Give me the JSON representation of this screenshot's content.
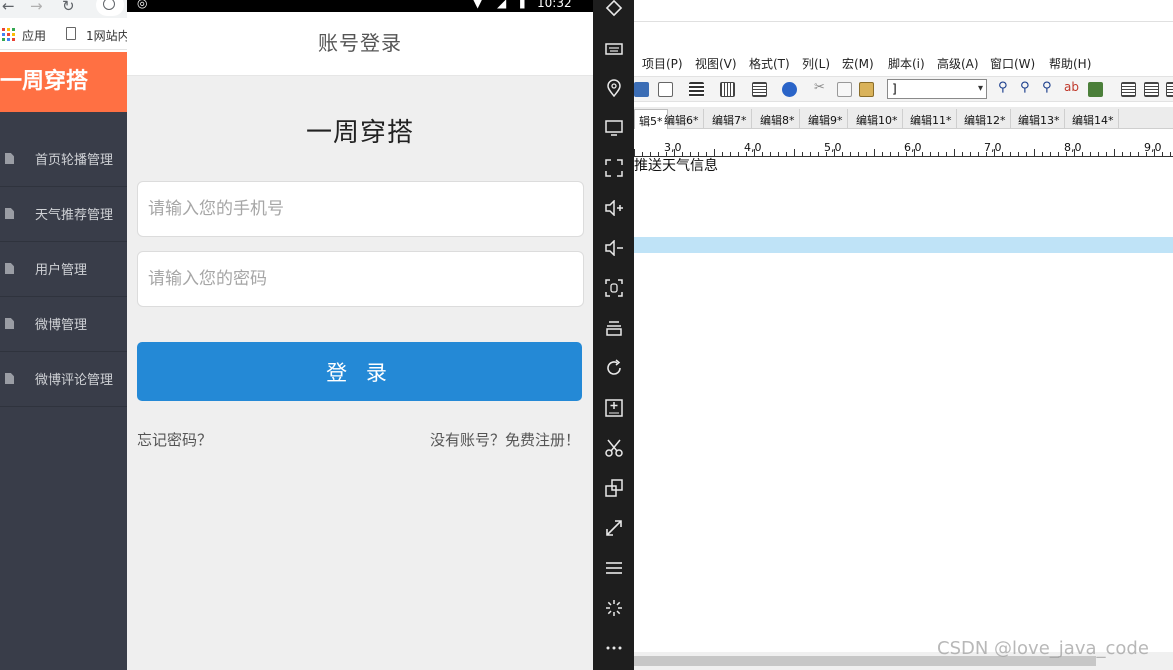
{
  "browser": {
    "bookmarks": {
      "apps_label": "应用",
      "site_label": "1网站内"
    }
  },
  "admin": {
    "brand": "一周穿搭",
    "menu": [
      {
        "label": "首页轮播管理"
      },
      {
        "label": "天气推荐管理"
      },
      {
        "label": "用户管理"
      },
      {
        "label": "微博管理"
      },
      {
        "label": "微博评论管理"
      }
    ]
  },
  "phone": {
    "status_time": "10:32",
    "header_title": "账号登录",
    "app_title": "一周穿搭",
    "phone_placeholder": "请输入您的手机号",
    "password_placeholder": "请输入您的密码",
    "login_label": "登 录",
    "forgot_label": "忘记密码？",
    "register_label": "没有账号？免费注册！"
  },
  "emulator": {
    "buttons": [
      "rotate-icon",
      "keyboard-icon",
      "location-icon",
      "screen-icon",
      "fullscreen-icon",
      "volume-up-icon",
      "volume-down-icon",
      "screenshot-icon",
      "shake-icon",
      "sync-icon",
      "install-apk-icon",
      "cut-icon",
      "multi-window-icon",
      "resize-icon",
      "menu-icon",
      "loading-icon",
      "more-icon"
    ]
  },
  "editor": {
    "menus": [
      "项目(P)",
      "视图(V)",
      "格式(T)",
      "列(L)",
      "宏(M)",
      "脚本(i)",
      "高级(A)",
      "窗口(W)",
      "帮助(H)"
    ],
    "combo_value": "]",
    "tabs": [
      "辑5*",
      "编辑6*",
      "编辑7*",
      "编辑8*",
      "编辑9*",
      "编辑10*",
      "编辑11*",
      "编辑12*",
      "编辑13*",
      "编辑14*"
    ],
    "ruler_labels": [
      "3,0",
      "4,0",
      "5,0",
      "6,0",
      "7,0",
      "8,0",
      "9,0"
    ],
    "text_line": "推送天气信息",
    "watermark": "CSDN @love_java_code"
  }
}
